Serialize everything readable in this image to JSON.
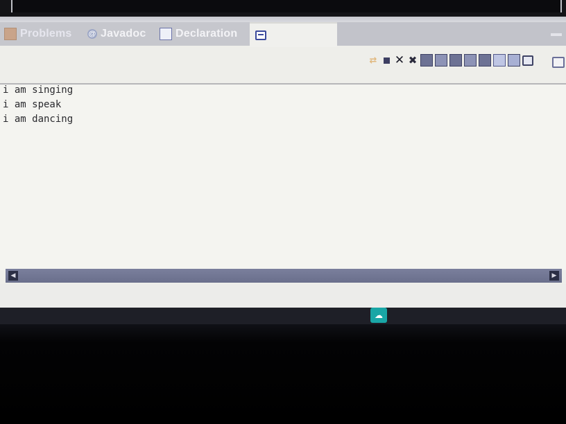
{
  "tabs": {
    "problems": "Problems",
    "javadoc": "Javadoc",
    "declaration": "Declaration",
    "console": ""
  },
  "toolbar_icons": [
    "link-console-icon",
    "terminate-icon",
    "remove-launch-icon",
    "remove-all-launches-icon",
    "clear-console-icon",
    "scroll-lock-icon",
    "word-wrap-icon",
    "show-stdout-icon",
    "show-stderr-icon",
    "pin-console-icon",
    "open-console-icon",
    "display-console-icon"
  ],
  "console": {
    "lines": [
      "i am singing",
      "i am speak",
      "i am dancing"
    ]
  },
  "colors": {
    "console_background": "#f4f4f0",
    "tabbar_background": "#c6c7cd",
    "accent_taskbar_button": "#19a6a6"
  }
}
